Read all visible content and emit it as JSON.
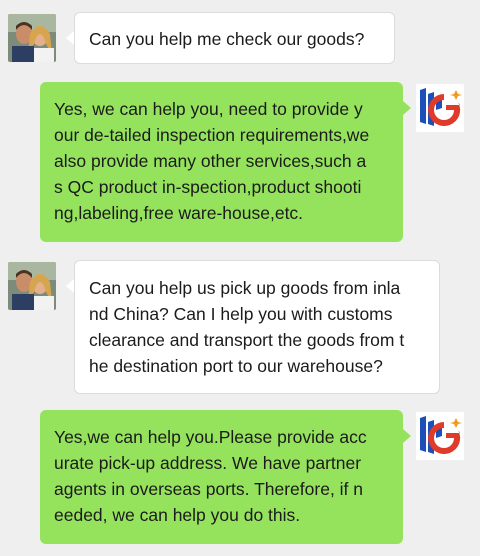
{
  "colors": {
    "background": "#efefef",
    "incoming_bubble": "#ffffff",
    "outgoing_bubble": "#95e35d",
    "logo_blue": "#1d4fb8",
    "logo_red": "#e03a2a",
    "logo_orange": "#f29a1e"
  },
  "messages": [
    {
      "sender": "customer",
      "avatar_icon": "couple-photo-avatar",
      "lines": [
        "Can you help me check our goods?"
      ]
    },
    {
      "sender": "agent",
      "avatar_icon": "hg-brand-logo",
      "lines": [
        "Yes, we can help you, need to provide y",
        "our de-tailed inspection requirements,we",
        "also provide many other services,such a",
        "s QC product in-spection,product shooti",
        "ng,labeling,free ware-house,etc."
      ]
    },
    {
      "sender": "customer",
      "avatar_icon": "couple-photo-avatar",
      "lines": [
        "Can you help us pick up goods from inla",
        "nd China? Can I help you with customs",
        "clearance and transport the goods from t",
        "he destination port to our warehouse?"
      ]
    },
    {
      "sender": "agent",
      "avatar_icon": "hg-brand-logo",
      "lines": [
        "Yes,we can help you.Please provide acc",
        "urate pick-up address. We have partner",
        "agents in overseas ports. Therefore, if n",
        "eeded, we can help you do this."
      ]
    }
  ]
}
